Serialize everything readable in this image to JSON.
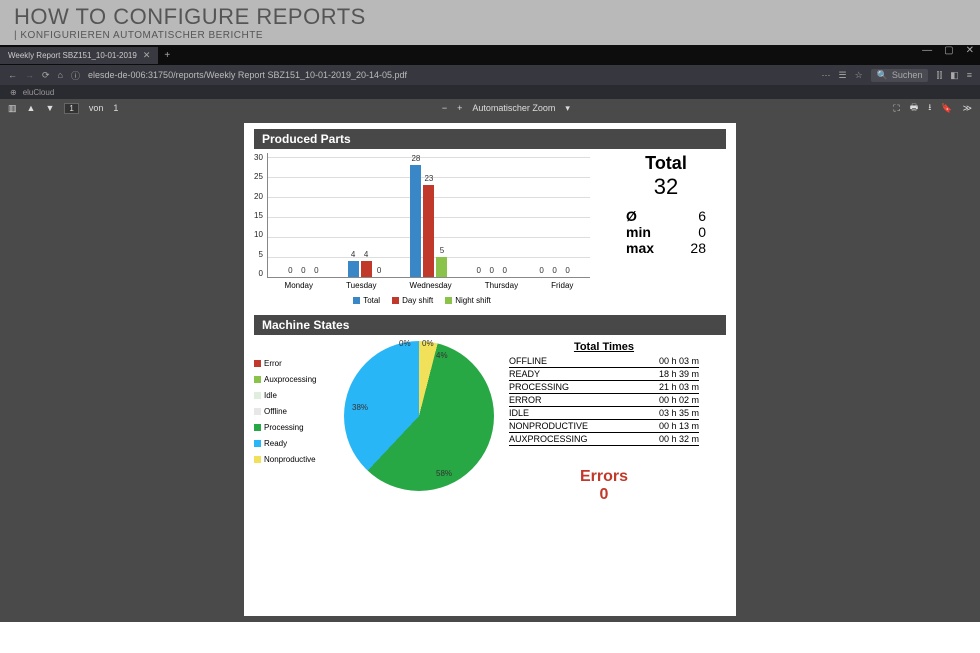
{
  "header": {
    "title": "HOW TO CONFIGURE REPORTS",
    "subtitle": "| KONFIGURIEREN AUTOMATISCHER BERICHTE"
  },
  "browser": {
    "tab_title": "Weekly Report SBZ151_10-01-2019",
    "url": "elesde-de-006:31750/reports/Weekly Report SBZ151_10-01-2019_20-14-05.pdf",
    "search_placeholder": "Suchen",
    "bookmark": "eluCloud"
  },
  "pdfviewer": {
    "page_current": "1",
    "page_sep": "von",
    "page_total": "1",
    "zoom_label": "Automatischer Zoom"
  },
  "produced": {
    "section_title": "Produced Parts",
    "y_ticks": [
      "30",
      "25",
      "20",
      "15",
      "10",
      "5",
      "0"
    ],
    "legend": {
      "total": "Total",
      "day": "Day shift",
      "night": "Night shift"
    },
    "totals": {
      "title": "Total",
      "value": "32",
      "avg_sym": "Ø",
      "avg": "6",
      "min_label": "min",
      "min": "0",
      "max_label": "max",
      "max": "28"
    }
  },
  "machine": {
    "section_title": "Machine States",
    "legend": {
      "error": "Error",
      "aux": "Auxprocessing",
      "idle": "Idle",
      "offline": "Offline",
      "processing": "Processing",
      "ready": "Ready",
      "np": "Nonproductive"
    },
    "pie_labels": {
      "offline": "0%",
      "idle": "0%",
      "np": "4%",
      "processing": "58%",
      "ready": "38%"
    },
    "times_title": "Total Times",
    "times": [
      {
        "k": "OFFLINE",
        "v": "00 h 03 m"
      },
      {
        "k": "READY",
        "v": "18 h 39 m"
      },
      {
        "k": "PROCESSING",
        "v": "21 h 03 m"
      },
      {
        "k": "ERROR",
        "v": "00 h 02 m"
      },
      {
        "k": "IDLE",
        "v": "03 h 35 m"
      },
      {
        "k": "NONPRODUCTIVE",
        "v": "00 h 13 m"
      },
      {
        "k": "AUXPROCESSING",
        "v": "00 h 32 m"
      }
    ],
    "errors_label": "Errors",
    "errors_value": "0"
  },
  "chart_data": [
    {
      "type": "bar",
      "title": "Produced Parts",
      "categories": [
        "Monday",
        "Tuesday",
        "Wednesday",
        "Thursday",
        "Friday"
      ],
      "series": [
        {
          "name": "Total",
          "values": [
            0,
            4,
            28,
            0,
            0
          ]
        },
        {
          "name": "Day shift",
          "values": [
            0,
            4,
            23,
            0,
            0
          ]
        },
        {
          "name": "Night shift",
          "values": [
            0,
            0,
            5,
            0,
            0
          ]
        }
      ],
      "ylim": [
        0,
        30
      ],
      "ylabel": "",
      "xlabel": ""
    },
    {
      "type": "pie",
      "title": "Machine States",
      "slices": [
        {
          "name": "Error",
          "pct": 0
        },
        {
          "name": "Auxprocessing",
          "pct": 0
        },
        {
          "name": "Idle",
          "pct": 0
        },
        {
          "name": "Offline",
          "pct": 0
        },
        {
          "name": "Processing",
          "pct": 58
        },
        {
          "name": "Ready",
          "pct": 38
        },
        {
          "name": "Nonproductive",
          "pct": 4
        }
      ]
    }
  ]
}
